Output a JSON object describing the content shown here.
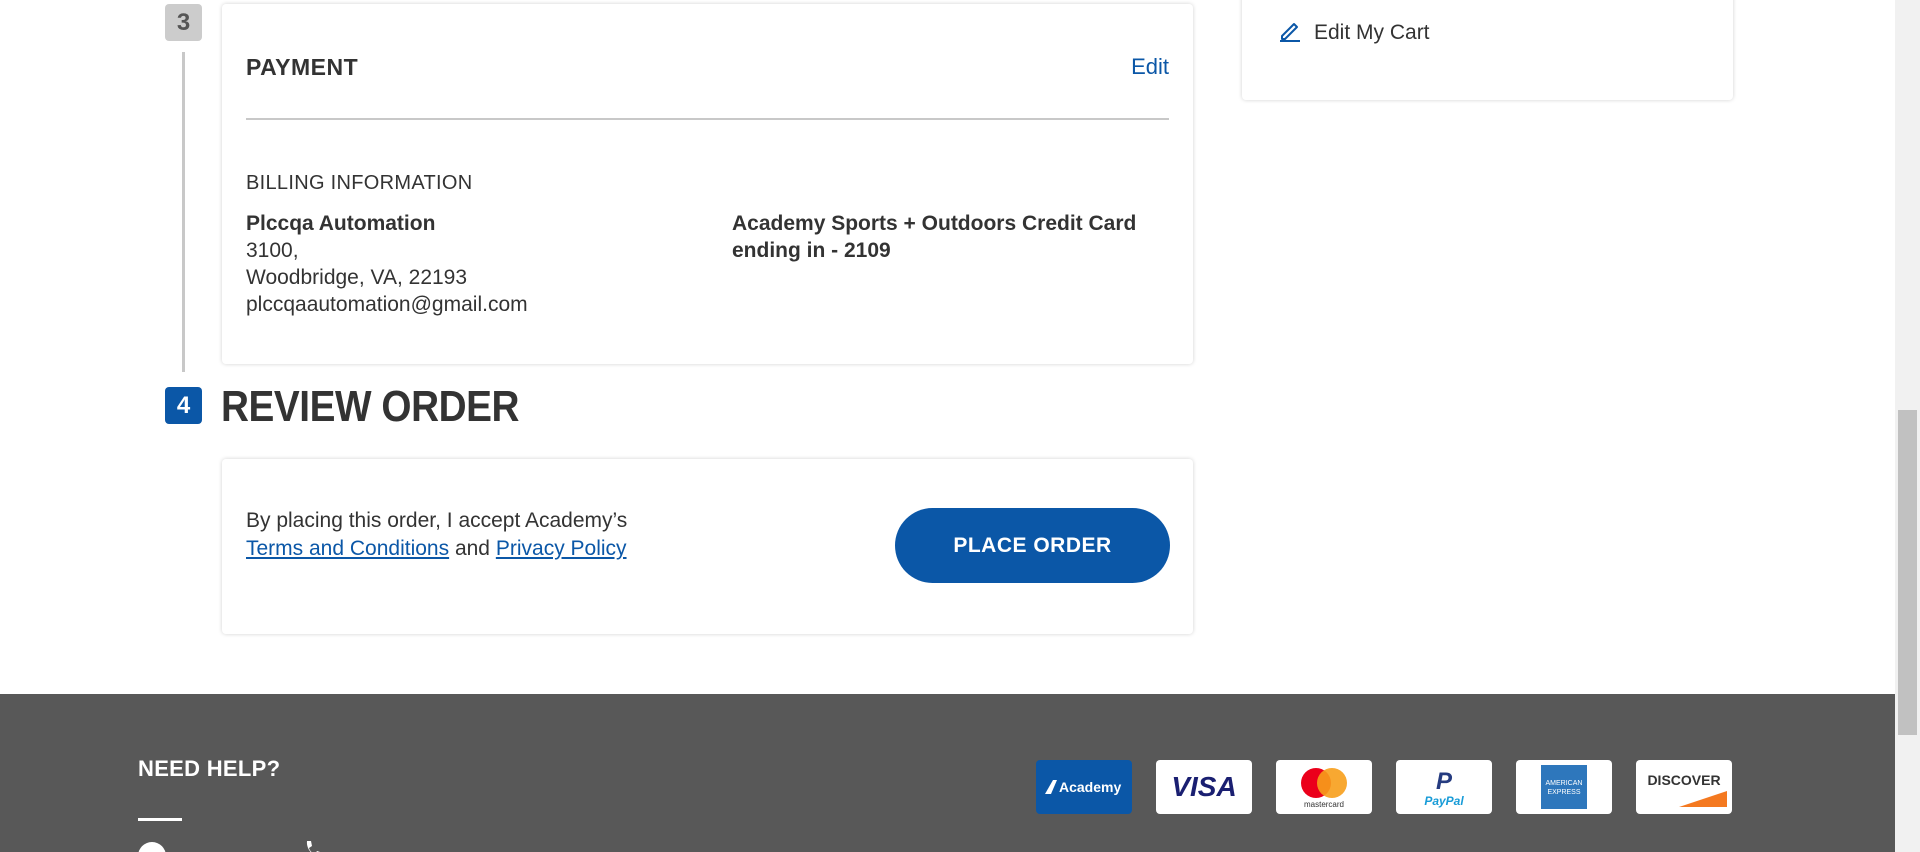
{
  "payment": {
    "step_number": "3",
    "title": "PAYMENT",
    "edit_label": "Edit",
    "billing_title": "BILLING INFORMATION",
    "billing_name": "Plccqa Automation",
    "billing_address_line1": "3100,",
    "billing_address_line2": "Woodbridge, VA, 22193",
    "billing_email": "plccqaautomation@gmail.com",
    "card_line1": "Academy Sports + Outdoors Credit Card",
    "card_line2": "ending in - 2109"
  },
  "review": {
    "step_number": "4",
    "title": "REVIEW ORDER",
    "accept_text": "By placing this order, I accept Academy’s",
    "terms_link": "Terms and Conditions",
    "and_text": "and",
    "privacy_link": "Privacy Policy",
    "place_order_label": "PLACE ORDER"
  },
  "cart": {
    "edit_cart_label": "Edit My Cart"
  },
  "footer": {
    "need_help": "NEED HELP?",
    "payment_methods": [
      "Academy",
      "VISA",
      "mastercard",
      "PayPal",
      "AMERICAN EXPRESS",
      "DISCOVER"
    ]
  },
  "colors": {
    "brand_blue": "#0b57a7",
    "footer_bg": "#585858"
  }
}
